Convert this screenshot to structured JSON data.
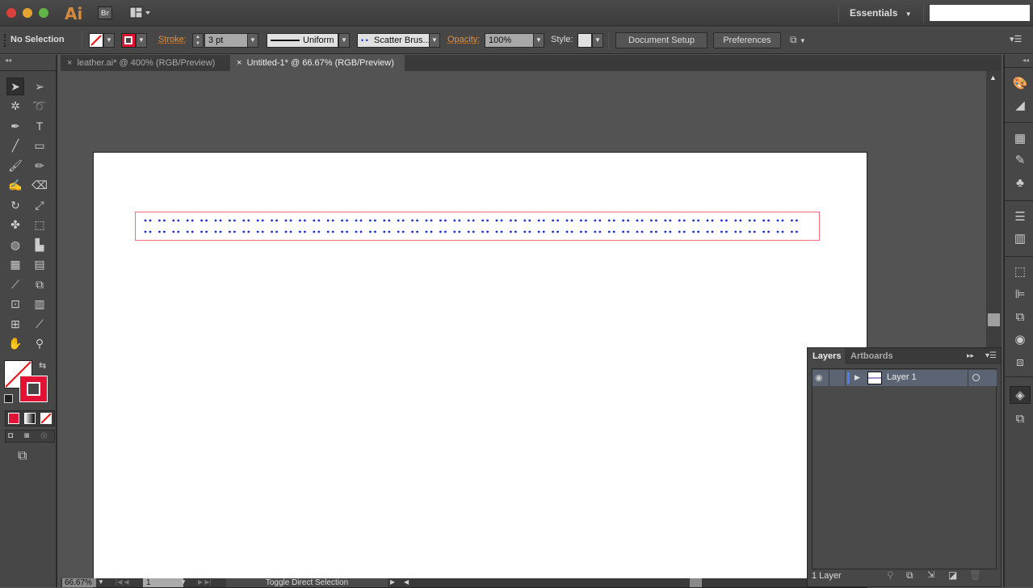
{
  "app": {
    "name": "Ai",
    "bridge_label": "Br",
    "workspace": "Essentials",
    "search_value": ""
  },
  "control_bar": {
    "selection": "No Selection",
    "stroke_label": "Stroke:",
    "stroke_weight": "3 pt",
    "profile": "Uniform",
    "brush": "Scatter Brus...",
    "opacity_label": "Opacity:",
    "opacity": "100%",
    "style_label": "Style:",
    "document_setup": "Document Setup",
    "preferences": "Preferences"
  },
  "tabs": [
    {
      "label": "leather.ai* @ 400% (RGB/Preview)",
      "active": false
    },
    {
      "label": "Untitled-1* @ 66.67% (RGB/Preview)",
      "active": true
    }
  ],
  "tools": [
    "selection",
    "direct-selection",
    "magic-wand",
    "lasso",
    "pen",
    "type",
    "line",
    "rectangle",
    "paintbrush",
    "pencil",
    "blob-brush",
    "eraser",
    "rotate",
    "scale",
    "warp",
    "free-transform",
    "shape-builder",
    "perspective-grid",
    "mesh",
    "gradient",
    "eyedropper",
    "blend",
    "symbol-sprayer",
    "column-graph",
    "artboard",
    "slice",
    "hand",
    "zoom"
  ],
  "colors": {
    "accent_red": "#ee1133",
    "selection_red": "#f26b7a",
    "dot_blue": "#1a2fd6",
    "orange_label": "#e8913a"
  },
  "layers_panel": {
    "tabs": [
      "Layers",
      "Artboards"
    ],
    "layers": [
      {
        "name": "Layer 1",
        "visible": true
      }
    ],
    "count": "1 Layer"
  },
  "status_bar": {
    "zoom": "66.67%",
    "artboard": "1",
    "tool_hint": "Toggle Direct Selection"
  }
}
